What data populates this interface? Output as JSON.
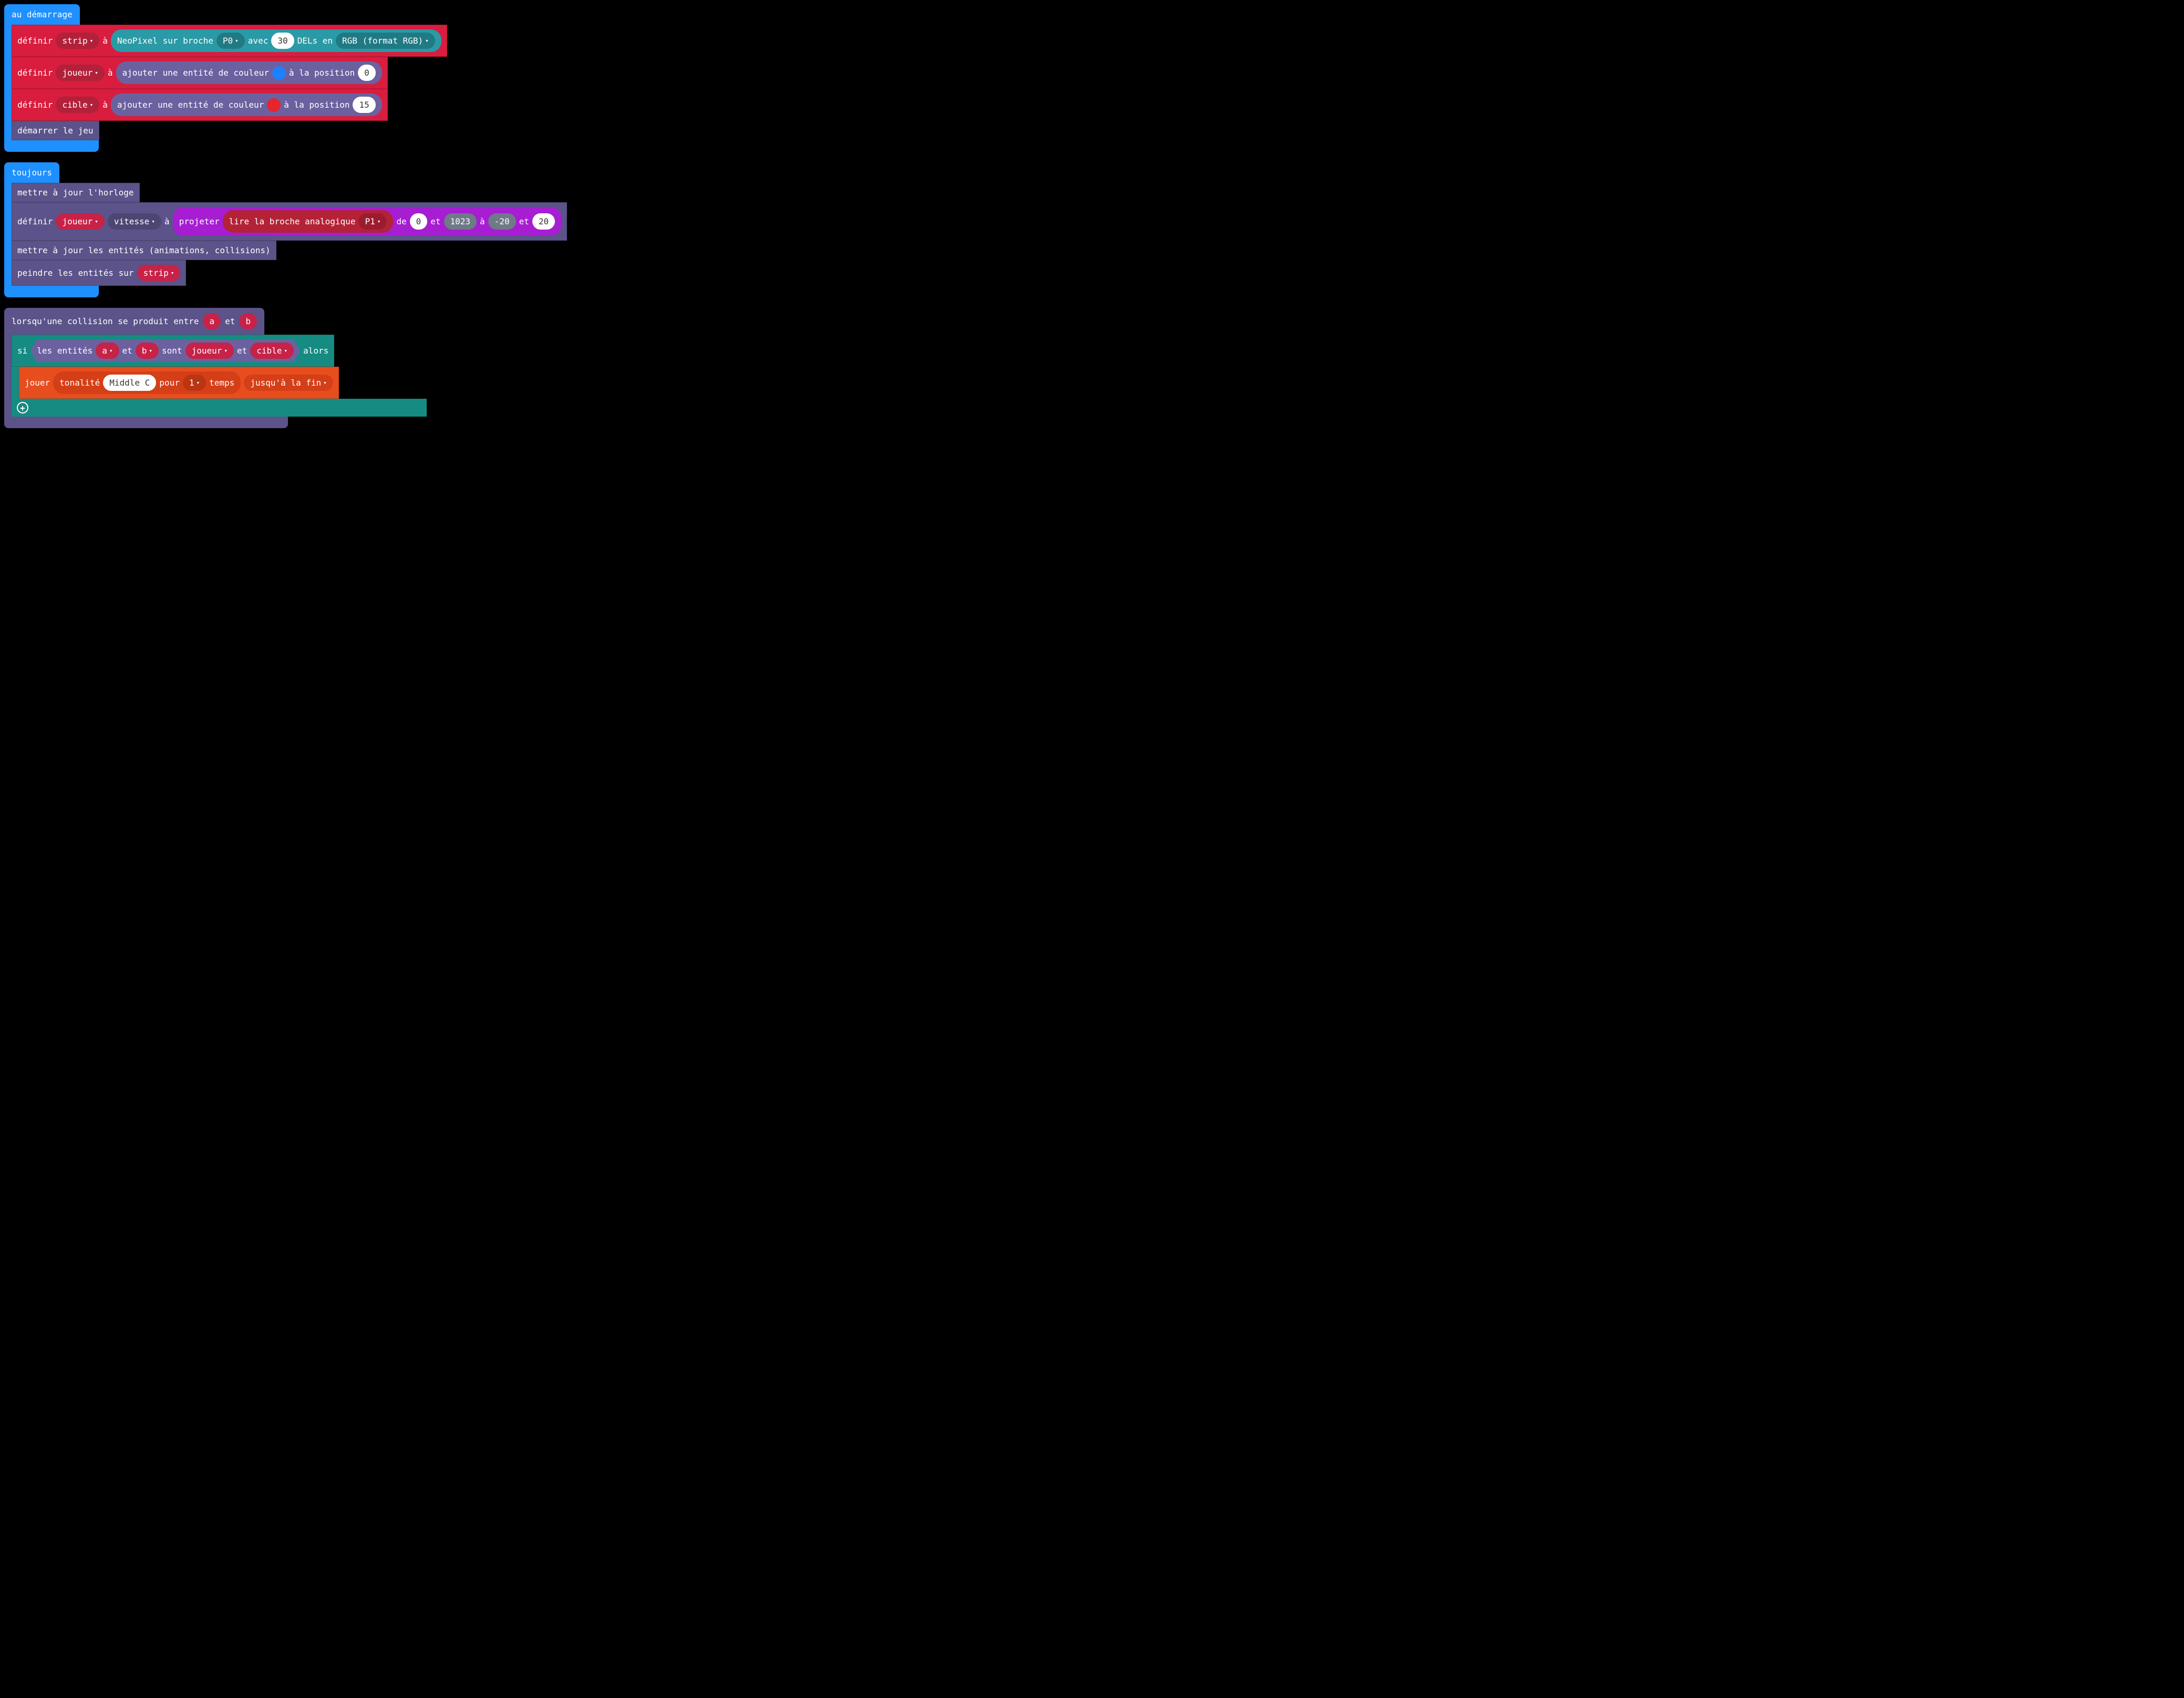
{
  "stack1": {
    "hat": "au démarrage",
    "b1": {
      "set": "définir",
      "var": "strip",
      "to": "à",
      "neopixel_label1": "NeoPixel sur broche",
      "pin": "P0",
      "with": "avec",
      "count": "30",
      "leds": "DELs en",
      "format": "RGB (format RGB)"
    },
    "b2": {
      "set": "définir",
      "var": "joueur",
      "to": "à",
      "add": "ajouter une entité de couleur",
      "atpos": "à la position",
      "pos": "0"
    },
    "b3": {
      "set": "définir",
      "var": "cible",
      "to": "à",
      "add": "ajouter une entité de couleur",
      "atpos": "à la position",
      "pos": "15"
    },
    "b4": "démarrer le jeu"
  },
  "stack2": {
    "hat": "toujours",
    "b1": "mettre à jour l'horloge",
    "b2": {
      "set": "définir",
      "var": "joueur",
      "prop": "vitesse",
      "to": "à",
      "map": "projeter",
      "read": "lire la broche analogique",
      "pin": "P1",
      "from": "de",
      "v1": "0",
      "and1": "et",
      "v2": "1023",
      "to2": "à",
      "v3": "-20",
      "and2": "et",
      "v4": "20"
    },
    "b3": "mettre à jour les entités (animations, collisions)",
    "b4": {
      "paint": "peindre les entités sur",
      "var": "strip"
    }
  },
  "stack3": {
    "hat": {
      "label1": "lorsqu'une collision se produit entre",
      "a": "a",
      "and": "et",
      "b": "b"
    },
    "if": {
      "if": "si",
      "entities": "les entités",
      "a": "a",
      "and1": "et",
      "b": "b",
      "are": "sont",
      "p1": "joueur",
      "and2": "et",
      "p2": "cible",
      "then": "alors"
    },
    "play": {
      "play": "jouer",
      "tone": "tonalité",
      "note": "Middle C",
      "for": "pour",
      "beat": "1",
      "beats": "temps",
      "until": "jusqu'à la fin"
    }
  },
  "colors": {
    "blue_swatch": "#1e7fff",
    "red_swatch": "#e6252c"
  }
}
